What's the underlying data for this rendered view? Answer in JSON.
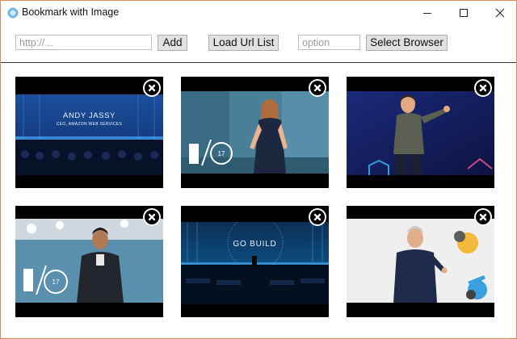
{
  "window": {
    "title": "Bookmark with Image"
  },
  "toolbar": {
    "url_placeholder": "http://...",
    "url_value": "",
    "add_label": "Add",
    "load_label": "Load Url List",
    "option_placeholder": "option",
    "option_value": "",
    "select_browser_label": "Select Browser"
  },
  "thumbnails": [
    {
      "scene": "stage-keynote-blue",
      "slide_title": "ANDY JASSY",
      "slide_subtitle": "CEO, AMAZON WEB SERVICES"
    },
    {
      "scene": "speaker-woman-io"
    },
    {
      "scene": "speaker-man-purple-stage"
    },
    {
      "scene": "speaker-man-io"
    },
    {
      "scene": "stage-go-build",
      "slide_title": "GO BUILD"
    },
    {
      "scene": "speaker-man-white-stage"
    }
  ],
  "io_badge_number": "17",
  "colors": {
    "window_border": "#e08a5a",
    "button_face": "#e1e1e1",
    "button_border": "#adadad",
    "separator": "#333333"
  }
}
